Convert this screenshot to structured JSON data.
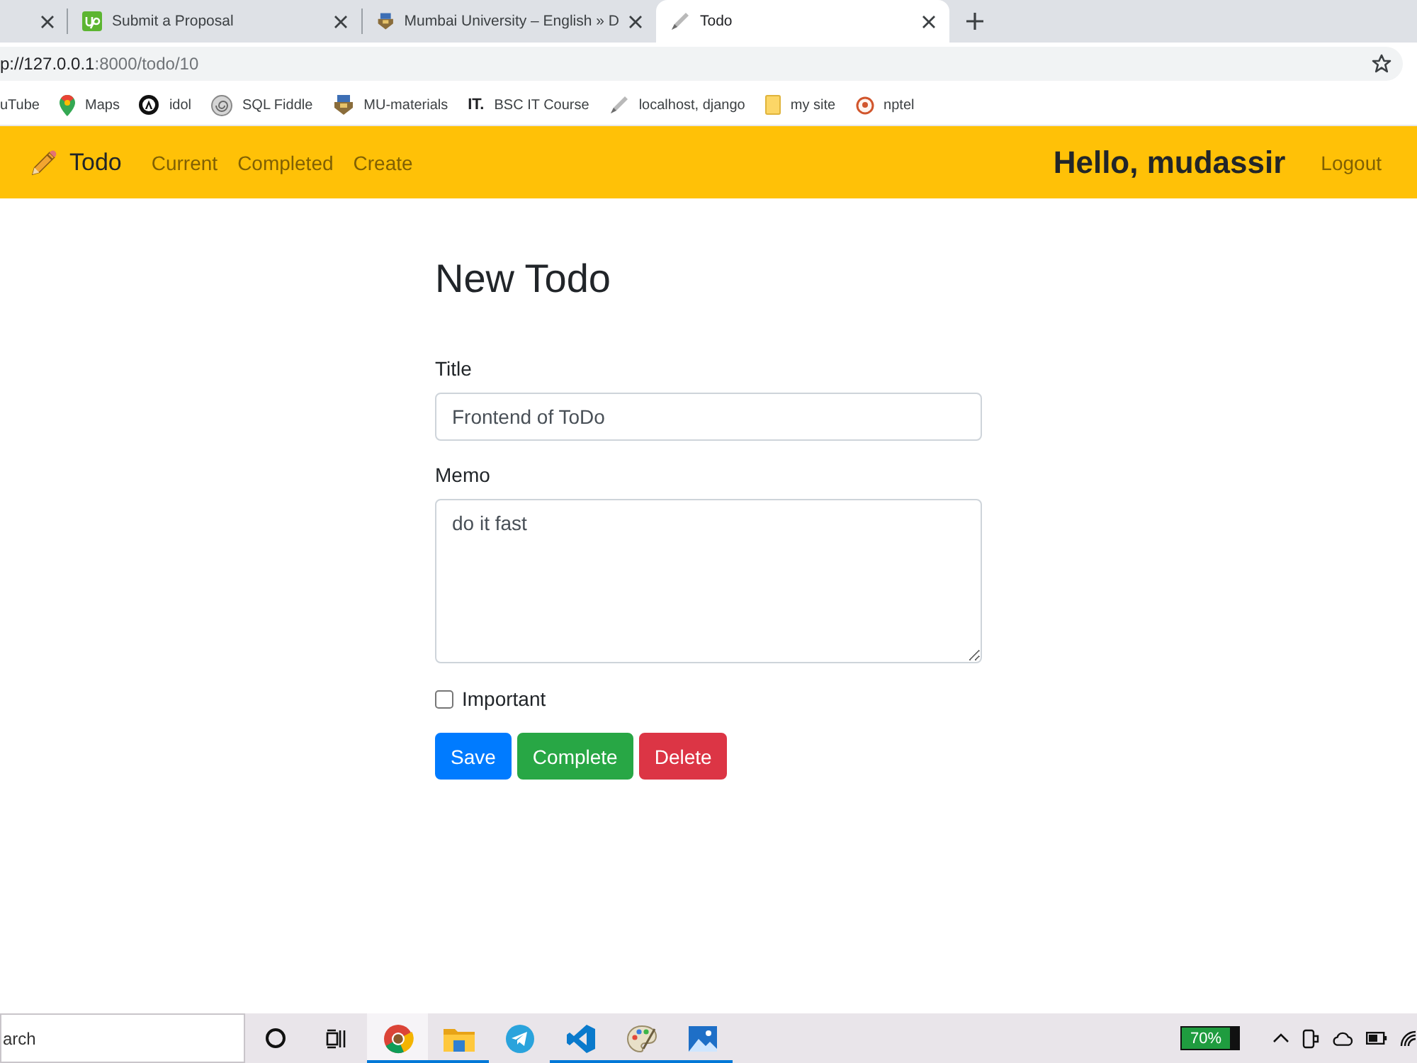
{
  "browser": {
    "tabs": [
      {
        "selected": false
      },
      {
        "title": "Submit a Proposal",
        "selected": false
      },
      {
        "title": "Mumbai University – English » D",
        "selected": false
      },
      {
        "title": "Todo",
        "selected": true
      }
    ],
    "address": {
      "host": "p://127.0.0.1",
      "path": ":8000/todo/10"
    },
    "bookmarks": [
      {
        "label": "uTube"
      },
      {
        "label": "Maps"
      },
      {
        "label": "idol"
      },
      {
        "label": "SQL Fiddle"
      },
      {
        "label": "MU-materials"
      },
      {
        "label": "BSC IT Course",
        "favicon_text": "IT."
      },
      {
        "label": "localhost, django"
      },
      {
        "label": "my site"
      },
      {
        "label": "nptel"
      }
    ]
  },
  "navbar": {
    "brand": "Todo",
    "links": [
      "Current",
      "Completed",
      "Create"
    ],
    "greeting": "Hello, mudassir",
    "logout": "Logout"
  },
  "form": {
    "heading": "New Todo",
    "fields": [
      {
        "label": "Title",
        "kind": "input",
        "value": "Frontend of ToDo"
      },
      {
        "label": "Memo",
        "kind": "textarea",
        "value": "do it fast"
      }
    ],
    "important": {
      "label": "Important",
      "checked": false
    },
    "buttons": [
      {
        "label": "Save",
        "kind": "primary"
      },
      {
        "label": "Complete",
        "kind": "success"
      },
      {
        "label": "Delete",
        "kind": "danger"
      }
    ]
  },
  "taskbar": {
    "search": {
      "placeholder": "arch"
    },
    "apps": [
      {
        "kind": "ring",
        "running": false,
        "selected": false
      },
      {
        "kind": "task-view",
        "running": false,
        "selected": false
      },
      {
        "kind": "browser",
        "running": true,
        "selected": true
      },
      {
        "kind": "folder",
        "running": true,
        "selected": false
      },
      {
        "kind": "paper-plane",
        "running": false,
        "selected": false
      },
      {
        "kind": "code",
        "running": true,
        "selected": false
      },
      {
        "kind": "palette",
        "running": true,
        "selected": false
      },
      {
        "kind": "picture",
        "running": true,
        "selected": false
      }
    ],
    "battery": "70%"
  }
}
